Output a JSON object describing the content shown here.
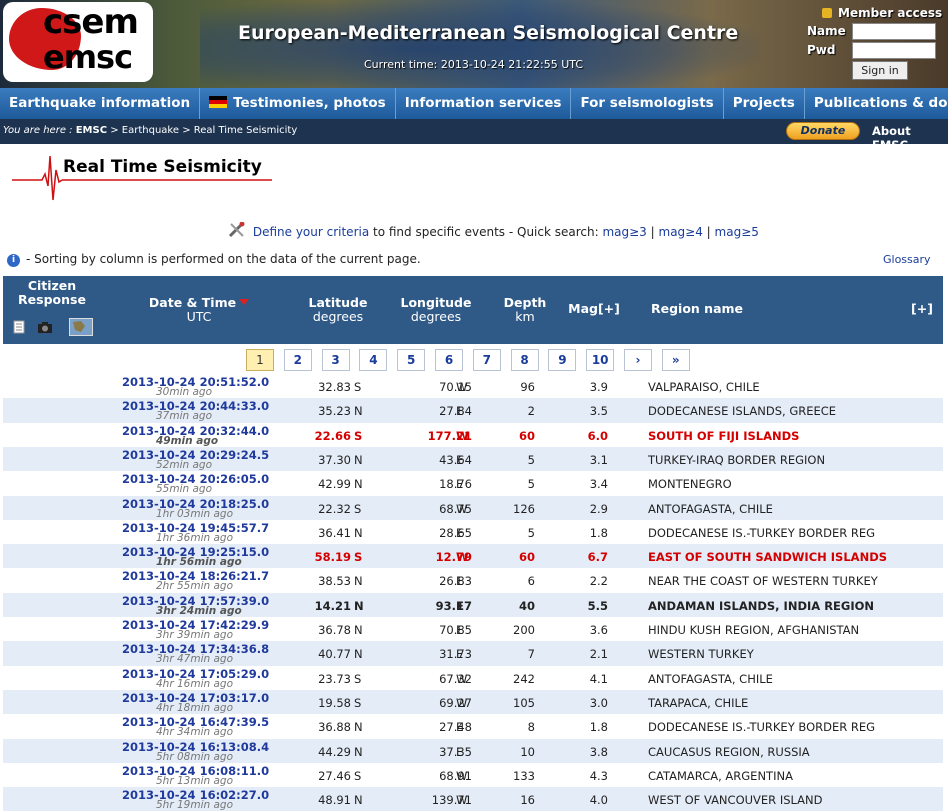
{
  "header": {
    "logo_top": "csem",
    "logo_bottom": "emsc",
    "title": "European-Mediterranean Seismological Centre",
    "current_time": "Current time: 2013-10-24 21:22:55 UTC",
    "member_access": "Member access",
    "name_label": "Name",
    "pwd_label": "Pwd",
    "signin_label": "Sign in"
  },
  "nav": [
    "Earthquake information",
    "Testimonies, photos",
    "Information services",
    "For seismologists",
    "Projects",
    "Publications & docs"
  ],
  "breadcrumb": {
    "prefix": "You are here :",
    "emsc": "EMSC",
    "rest": "> Earthquake > Real Time Seismicity"
  },
  "donate_label": "Donate",
  "about_label": "About EMSC",
  "page_title": "Real Time Seismicity",
  "criteria": {
    "link": "Define your criteria",
    "text": " to find specific events - Quick search: ",
    "mag3": "mag≥3",
    "sep1": " | ",
    "mag4": "mag≥4",
    "sep2": " | ",
    "mag5": "mag≥5"
  },
  "sort_note": "- Sorting by column is performed on the data of the current page.",
  "glossary": "Glossary",
  "table_header": {
    "citizen1": "Citizen",
    "citizen2": "Response",
    "date": "Date & Time",
    "utc": "UTC",
    "lat": "Latitude",
    "lat_unit": "degrees",
    "lon": "Longitude",
    "lon_unit": "degrees",
    "depth": "Depth",
    "depth_unit": "km",
    "mag": "Mag[+]",
    "region": "Region name",
    "plus": "[+]"
  },
  "pages": [
    "1",
    "2",
    "3",
    "4",
    "5",
    "6",
    "7",
    "8",
    "9",
    "10",
    "›",
    "»"
  ],
  "rows": [
    {
      "date": "2013-10-24   20:51:52.0",
      "ago": "30min ago",
      "lat": "32.83",
      "ns": "S",
      "lon": "70.15",
      "ew": "W",
      "depth": "96",
      "mag": "3.9",
      "region": "VALPARAISO, CHILE",
      "style": ""
    },
    {
      "date": "2013-10-24   20:44:33.0",
      "ago": "37min ago",
      "lat": "35.23",
      "ns": "N",
      "lon": "27.84",
      "ew": "E",
      "depth": "2",
      "mag": "3.5",
      "region": "DODECANESE ISLANDS, GREECE",
      "style": ""
    },
    {
      "date": "2013-10-24   20:32:44.0",
      "ago": "49min ago",
      "lat": "22.66",
      "ns": "S",
      "lon": "177.21",
      "ew": "W",
      "depth": "60",
      "mag": "6.0",
      "region": "SOUTH OF FIJI ISLANDS",
      "style": "red"
    },
    {
      "date": "2013-10-24   20:29:24.5",
      "ago": "52min ago",
      "lat": "37.30",
      "ns": "N",
      "lon": "43.64",
      "ew": "E",
      "depth": "5",
      "mag": "3.1",
      "region": "TURKEY-IRAQ BORDER REGION",
      "style": ""
    },
    {
      "date": "2013-10-24   20:26:05.0",
      "ago": "55min ago",
      "lat": "42.99",
      "ns": "N",
      "lon": "18.76",
      "ew": "E",
      "depth": "5",
      "mag": "3.4",
      "region": "MONTENEGRO",
      "style": ""
    },
    {
      "date": "2013-10-24   20:18:25.0",
      "ago": "1hr 03min ago",
      "lat": "22.32",
      "ns": "S",
      "lon": "68.75",
      "ew": "W",
      "depth": "126",
      "mag": "2.9",
      "region": "ANTOFAGASTA, CHILE",
      "style": ""
    },
    {
      "date": "2013-10-24   19:45:57.7",
      "ago": "1hr 36min ago",
      "lat": "36.41",
      "ns": "N",
      "lon": "28.65",
      "ew": "E",
      "depth": "5",
      "mag": "1.8",
      "region": "DODECANESE IS.-TURKEY BORDER REG",
      "style": ""
    },
    {
      "date": "2013-10-24   19:25:15.0",
      "ago": "1hr 56min ago",
      "lat": "58.19",
      "ns": "S",
      "lon": "12.79",
      "ew": "W",
      "depth": "60",
      "mag": "6.7",
      "region": "EAST OF SOUTH SANDWICH ISLANDS",
      "style": "red"
    },
    {
      "date": "2013-10-24   18:26:21.7",
      "ago": "2hr 55min ago",
      "lat": "38.53",
      "ns": "N",
      "lon": "26.83",
      "ew": "E",
      "depth": "6",
      "mag": "2.2",
      "region": "NEAR THE COAST OF WESTERN TURKEY",
      "style": ""
    },
    {
      "date": "2013-10-24   17:57:39.0",
      "ago": "3hr 24min ago",
      "lat": "14.21",
      "ns": "N",
      "lon": "93.17",
      "ew": "E",
      "depth": "40",
      "mag": "5.5",
      "region": "ANDAMAN ISLANDS, INDIA REGION",
      "style": "bold"
    },
    {
      "date": "2013-10-24   17:42:29.9",
      "ago": "3hr 39min ago",
      "lat": "36.78",
      "ns": "N",
      "lon": "70.85",
      "ew": "E",
      "depth": "200",
      "mag": "3.6",
      "region": "HINDU KUSH REGION, AFGHANISTAN",
      "style": ""
    },
    {
      "date": "2013-10-24   17:34:36.8",
      "ago": "3hr 47min ago",
      "lat": "40.77",
      "ns": "N",
      "lon": "31.73",
      "ew": "E",
      "depth": "7",
      "mag": "2.1",
      "region": "WESTERN TURKEY",
      "style": ""
    },
    {
      "date": "2013-10-24   17:05:29.0",
      "ago": "4hr 16min ago",
      "lat": "23.73",
      "ns": "S",
      "lon": "67.32",
      "ew": "W",
      "depth": "242",
      "mag": "4.1",
      "region": "ANTOFAGASTA, CHILE",
      "style": ""
    },
    {
      "date": "2013-10-24   17:03:17.0",
      "ago": "4hr 18min ago",
      "lat": "19.58",
      "ns": "S",
      "lon": "69.27",
      "ew": "W",
      "depth": "105",
      "mag": "3.0",
      "region": "TARAPACA, CHILE",
      "style": ""
    },
    {
      "date": "2013-10-24   16:47:39.5",
      "ago": "4hr 34min ago",
      "lat": "36.88",
      "ns": "N",
      "lon": "27.48",
      "ew": "E",
      "depth": "8",
      "mag": "1.8",
      "region": "DODECANESE IS.-TURKEY BORDER REG",
      "style": ""
    },
    {
      "date": "2013-10-24   16:13:08.4",
      "ago": "5hr 08min ago",
      "lat": "44.29",
      "ns": "N",
      "lon": "37.35",
      "ew": "E",
      "depth": "10",
      "mag": "3.8",
      "region": "CAUCASUS REGION, RUSSIA",
      "style": ""
    },
    {
      "date": "2013-10-24   16:08:11.0",
      "ago": "5hr 13min ago",
      "lat": "27.46",
      "ns": "S",
      "lon": "68.91",
      "ew": "W",
      "depth": "133",
      "mag": "4.3",
      "region": "CATAMARCA, ARGENTINA",
      "style": ""
    },
    {
      "date": "2013-10-24   16:02:27.0",
      "ago": "5hr 19min ago",
      "lat": "48.91",
      "ns": "N",
      "lon": "139.71",
      "ew": "W",
      "depth": "16",
      "mag": "4.0",
      "region": "WEST OF VANCOUVER ISLAND",
      "style": ""
    }
  ]
}
